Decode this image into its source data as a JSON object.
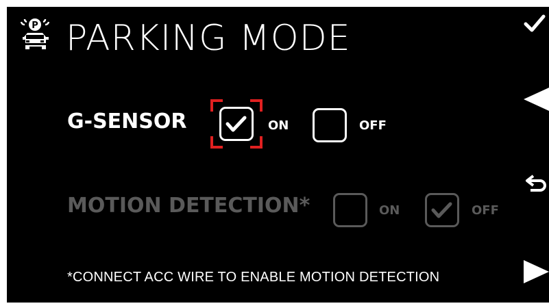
{
  "screen": {
    "title": "PARKING MODE",
    "icon": "car-parking-icon",
    "parking_badge": "P"
  },
  "gsensor": {
    "label": "G-SENSOR",
    "on_label": "ON",
    "off_label": "OFF",
    "selected": "ON",
    "enabled": true
  },
  "motion_detection": {
    "label": "MOTION DETECTION*",
    "on_label": "ON",
    "off_label": "OFF",
    "selected": "OFF",
    "enabled": false
  },
  "footnote": "*CONNECT ACC WIRE TO ENABLE MOTION DETECTION",
  "side_buttons": [
    "check-icon",
    "left-arrow-icon",
    "back-icon",
    "right-arrow-icon"
  ],
  "colors": {
    "background": "#000000",
    "text": "#ffffff",
    "disabled": "#5a5a5a",
    "focus": "#e02020"
  }
}
